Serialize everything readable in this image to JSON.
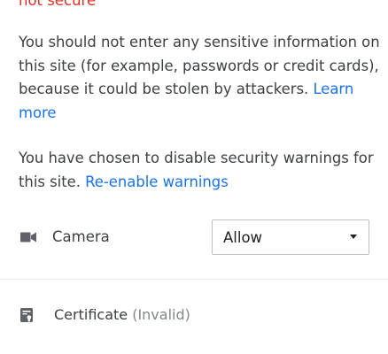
{
  "header": {
    "title": "not secure"
  },
  "warning": {
    "text": "You should not enter any sensitive information on this site (for example, passwords or credit cards), because it could be stolen by attackers.",
    "learn_more_label": "Learn more"
  },
  "security_warnings": {
    "text": "You have chosen to disable security warnings for this site.",
    "reenable_label": "Re-enable warnings"
  },
  "permissions": [
    {
      "icon": "camera-icon",
      "label": "Camera",
      "value": "Allow"
    }
  ],
  "certificate": {
    "icon": "certificate-icon",
    "label": "Certificate",
    "status": "(Invalid)"
  },
  "colors": {
    "title": "#d93025",
    "link": "#1a73e8",
    "text": "#3c4043",
    "icon": "#5f6368"
  }
}
